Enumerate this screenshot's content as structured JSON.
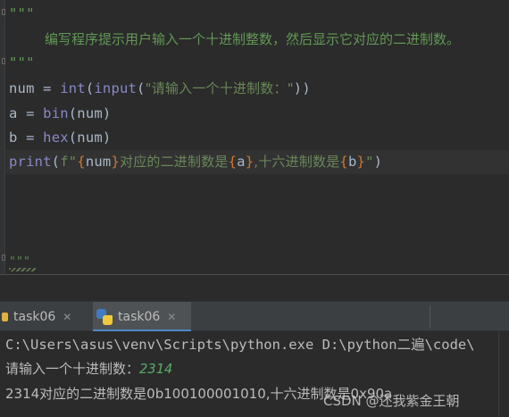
{
  "editor": {
    "docstring_open": "\"\"\"",
    "docstring_text": "编写程序提示用户输入一个十进制整数，然后显示它对应的二进制数。",
    "docstring_close": "\"\"\"",
    "line_num": {
      "var": "num",
      "eq": " = ",
      "func1": "int",
      "p1": "(",
      "func2": "input",
      "p2": "(",
      "str": "\"请输入一个十进制数：\"",
      "close": "))"
    },
    "line_a": {
      "var": "a",
      "eq": " = ",
      "func": "bin",
      "args": "(num)"
    },
    "line_b": {
      "var": "b",
      "eq": " = ",
      "func": "hex",
      "args": "(num)"
    },
    "line_print": {
      "func": "print",
      "open": "(",
      "prefix": "f\"",
      "lb1": "{",
      "v1": "num",
      "rb1": "}",
      "text1": "对应的二进制数是",
      "lb2": "{",
      "v2": "a",
      "rb2": "}",
      "text2": ",十六进制数是",
      "lb3": "{",
      "v3": "b",
      "rb3": "}",
      "suffix": "\"",
      "close": ")"
    },
    "bottom_fragment": "\"\"\""
  },
  "run_tabs": [
    {
      "label": "task06",
      "active": false
    },
    {
      "label": "task06",
      "active": true
    }
  ],
  "console": {
    "line1": "C:\\Users\\asus\\venv\\Scripts\\python.exe D:\\python二遍\\code\\",
    "line2_prompt": "请输入一个十进制数：",
    "line2_input": "2314",
    "line3": "2314对应的二进制数是0b100100001010,十六进制数是0x90a"
  },
  "watermark": "CSDN @还我紫金王朝",
  "colors": {
    "editor_bg": "#2b2b2b",
    "docstring": "#629755",
    "builtin": "#8888c6",
    "string": "#6a8759",
    "brace": "#cc7832",
    "identifier": "#a9b7c6",
    "tab_active_underline": "#4a88c7",
    "console_input": "#59a869"
  },
  "icons": {
    "tab_inactive": "file-icon",
    "tab_active": "python-icon",
    "tab_close": "close-icon"
  }
}
